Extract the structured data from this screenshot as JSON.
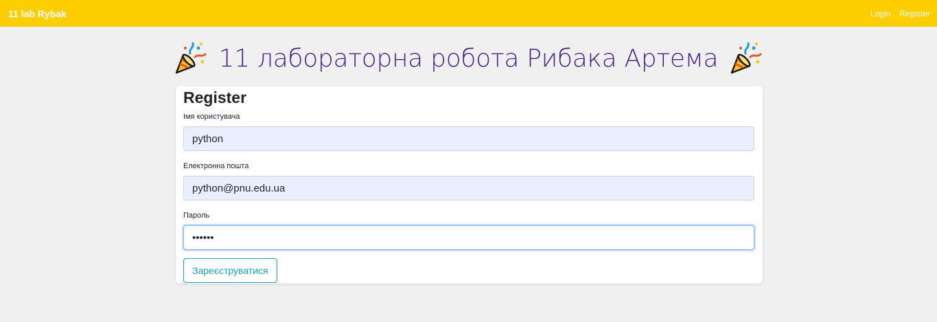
{
  "navbar": {
    "brand": "11 lab Rybak",
    "links": [
      {
        "label": "Login"
      },
      {
        "label": "Register"
      }
    ],
    "background": "#ffce00"
  },
  "header": {
    "title": "11 лабораторна робота Рибака Артема",
    "title_color": "#4a2387",
    "left_icon": "party-popper-icon",
    "right_icon": "party-popper-icon"
  },
  "form": {
    "title": "Register",
    "fields": [
      {
        "label": "Імя користувача",
        "value": "python"
      },
      {
        "label": "Електронна пошта",
        "value": "python@pnu.edu.ua"
      },
      {
        "label": "Пароль",
        "value": "••••••"
      }
    ],
    "submit_label": "Зареєструватися",
    "submit_color": "#17a2b8"
  }
}
